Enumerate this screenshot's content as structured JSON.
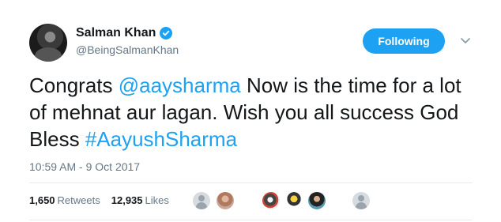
{
  "user": {
    "name": "Salman Khan",
    "handle": "@BeingSalmanKhan",
    "verified": true
  },
  "follow_button": {
    "label": "Following"
  },
  "tweet": {
    "part1": "Congrats ",
    "mention": "@aaysharma",
    "part2": " Now is the time for a lot of mehnat aur lagan. Wish you all success God Bless ",
    "hashtag": "#AayushSharma"
  },
  "timestamp": "10:59 AM - 9 Oct 2017",
  "stats": {
    "retweets_count": "1,650",
    "retweets_label": "Retweets",
    "likes_count": "12,935",
    "likes_label": "Likes"
  },
  "colors": {
    "accent": "#1da1f2",
    "muted": "#657786",
    "text": "#14171a",
    "divider": "#e6ecf0"
  },
  "icons": {
    "verified": "verified-badge-icon",
    "more": "chevron-down-icon"
  }
}
